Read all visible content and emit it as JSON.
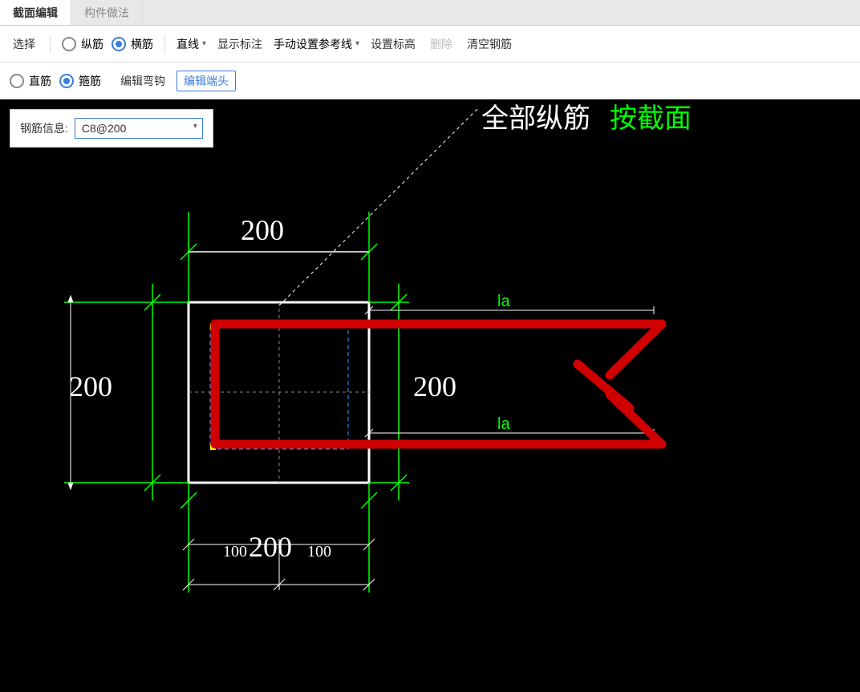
{
  "tabs": {
    "section_edit": "截面编辑",
    "component_method": "构件做法"
  },
  "toolbar1": {
    "select_label": "选择",
    "radio_longitudinal": "纵筋",
    "radio_transverse": "横筋",
    "line_label": "直线",
    "show_annotation": "显示标注",
    "manual_refline": "手动设置参考线",
    "set_elevation": "设置标高",
    "delete_label": "删除",
    "clear_rebar": "清空钢筋"
  },
  "toolbar2": {
    "radio_straight": "直筋",
    "radio_stirrup": "箍筋",
    "edit_hook": "编辑弯钩",
    "edit_end": "编辑端头"
  },
  "info": {
    "label": "钢筋信息:",
    "value": "C8@200"
  },
  "canvas": {
    "title_text": "全部纵筋",
    "title_green": "按截面",
    "dim_top": "200",
    "dim_left": "200",
    "dim_inner_right": "200",
    "dim_bottom": "200",
    "dim_bottom_small_left": "100",
    "dim_bottom_small_right": "100",
    "leader_top": "la",
    "leader_bottom": "la"
  }
}
